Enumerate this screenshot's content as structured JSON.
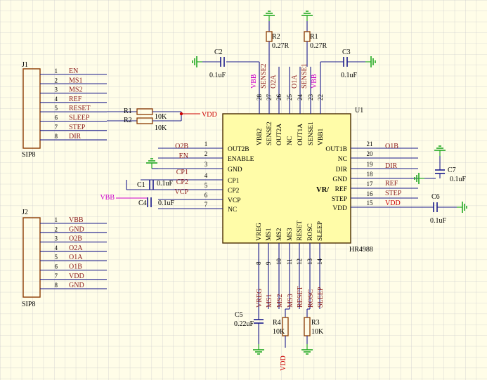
{
  "colors": {
    "background": "#fffde8",
    "grid": "#cfcfcf",
    "wire": "#1a1a8c",
    "chip_fill": "#fffca8",
    "chip_border": "#4a2c00",
    "body_text": "#000000",
    "net_label": "#8b1a1a",
    "power_label": "#cc0000",
    "ground": "#22aa22",
    "pink": "#cc00cc",
    "resistor": "#8b3a00"
  },
  "ic": {
    "designator": "U1",
    "part": "HR4988",
    "left_pins": [
      {
        "num": "1",
        "name": "OUT2B"
      },
      {
        "num": "2",
        "name": "ENABLE"
      },
      {
        "num": "3",
        "name": "GND"
      },
      {
        "num": "4",
        "name": "CP1"
      },
      {
        "num": "5",
        "name": "CP2"
      },
      {
        "num": "6",
        "name": "VCP"
      },
      {
        "num": "7",
        "name": "NC"
      }
    ],
    "right_pins": [
      {
        "num": "21",
        "name": "OUT1B"
      },
      {
        "num": "20",
        "name": "NC"
      },
      {
        "num": "19",
        "name": "DIR"
      },
      {
        "num": "18",
        "name": "GND"
      },
      {
        "num": "17",
        "name": "REF"
      },
      {
        "num": "16",
        "name": "STEP"
      },
      {
        "num": "15",
        "name": "VDD"
      }
    ],
    "top_pins": [
      {
        "num": "28",
        "name": "VBB2"
      },
      {
        "num": "27",
        "name": "SENSE2"
      },
      {
        "num": "26",
        "name": "OUT2A"
      },
      {
        "num": "25",
        "name": "NC"
      },
      {
        "num": "24",
        "name": "OUT1A"
      },
      {
        "num": "23",
        "name": "SENSE1"
      },
      {
        "num": "22",
        "name": "VBB1"
      }
    ],
    "bottom_pins": [
      {
        "num": "8",
        "name": "VREG"
      },
      {
        "num": "9",
        "name": "MS1"
      },
      {
        "num": "10",
        "name": "MS2"
      },
      {
        "num": "11",
        "name": "MS3"
      },
      {
        "num": "12",
        "name": "RESET"
      },
      {
        "num": "13",
        "name": "ROSC"
      },
      {
        "num": "14",
        "name": "SLEEP"
      }
    ],
    "vr_label": "VR/"
  },
  "j1": {
    "designator": "J1",
    "footprint": "SIP8",
    "pins": [
      {
        "num": "1",
        "net": "EN"
      },
      {
        "num": "2",
        "net": "MS1"
      },
      {
        "num": "3",
        "net": "MS2"
      },
      {
        "num": "4",
        "net": "REF"
      },
      {
        "num": "5",
        "net": "RESET"
      },
      {
        "num": "6",
        "net": "SLEEP"
      },
      {
        "num": "7",
        "net": "STEP"
      },
      {
        "num": "8",
        "net": "DIR"
      }
    ]
  },
  "j2": {
    "designator": "J2",
    "footprint": "SIP8",
    "pins": [
      {
        "num": "1",
        "net": "VBB"
      },
      {
        "num": "2",
        "net": "GND"
      },
      {
        "num": "3",
        "net": "O2B"
      },
      {
        "num": "4",
        "net": "O2A"
      },
      {
        "num": "5",
        "net": "O1A"
      },
      {
        "num": "6",
        "net": "O1B"
      },
      {
        "num": "7",
        "net": "VDD"
      },
      {
        "num": "8",
        "net": "GND"
      }
    ]
  },
  "left_nets": [
    "O2B",
    "EN",
    "",
    "CP1",
    "CP2",
    "VCP",
    ""
  ],
  "right_nets": [
    "O1B",
    "",
    "DIR",
    "",
    "REF",
    "STEP",
    "VDD"
  ],
  "top_nets": [
    "VBB",
    "SENSE2",
    "O2A",
    "",
    "O1A",
    "SENSE1",
    "VBB"
  ],
  "bottom_nets": [
    "VREG",
    "MS1",
    "MS2",
    "MS3",
    "RESET",
    "ROSC",
    "SLEEP"
  ],
  "components": {
    "r1_top": {
      "ref": "R1",
      "value": "0.27R"
    },
    "r2_top": {
      "ref": "R2",
      "value": "0.27R"
    },
    "r1_left": {
      "ref": "R1",
      "value": "10K"
    },
    "r2_left": {
      "ref": "R2",
      "value": "10K"
    },
    "r3": {
      "ref": "R3",
      "value": "10K"
    },
    "r4": {
      "ref": "R4",
      "value": "10K"
    },
    "c1": {
      "ref": "C1",
      "value": "0.1uF"
    },
    "c2": {
      "ref": "C2",
      "value": "0.1uF"
    },
    "c3": {
      "ref": "C3",
      "value": "0.1uF"
    },
    "c4": {
      "ref": "C4",
      "value": "0.1uF"
    },
    "c5": {
      "ref": "C5",
      "value": "0.22uF"
    },
    "c6": {
      "ref": "C6",
      "value": "0.1uF"
    },
    "c7": {
      "ref": "C7",
      "value": "0.1uF"
    }
  },
  "power_labels": {
    "vdd_left": "VDD",
    "vdd_bottom": "VDD",
    "vbb_left": "VBB"
  }
}
